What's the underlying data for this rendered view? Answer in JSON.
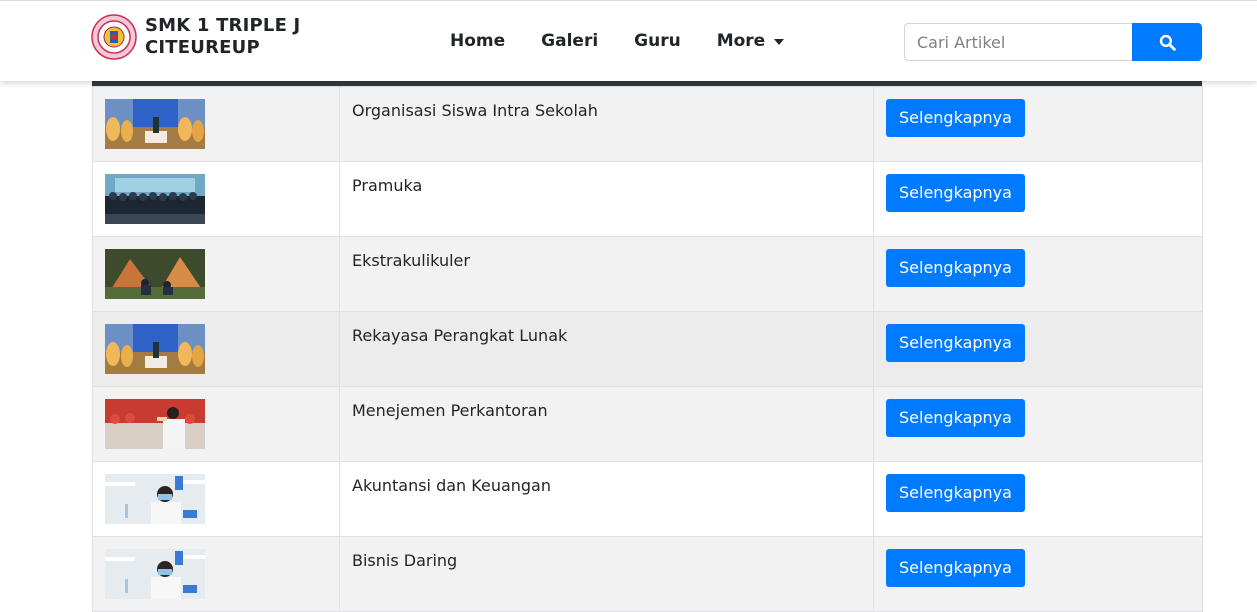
{
  "brand": {
    "line1": "SMK 1 TRIPLE J",
    "line2": "CITEUREUP"
  },
  "nav": [
    {
      "label": "Home"
    },
    {
      "label": "Galeri"
    },
    {
      "label": "Guru"
    },
    {
      "label": "More",
      "dropdown": true
    }
  ],
  "search": {
    "placeholder": "Cari Artikel",
    "icon": "search-icon"
  },
  "colors": {
    "primary": "#007bff",
    "table_header": "#343a40",
    "row_stripe": "#f2f2f2"
  },
  "rows": [
    {
      "title": "Organisasi Siswa Intra Sekolah",
      "button": "Selengkapnya",
      "image": "stage-ceremony"
    },
    {
      "title": "Pramuka",
      "button": "Selengkapnya",
      "image": "group-photo"
    },
    {
      "title": "Ekstrakulikuler",
      "button": "Selengkapnya",
      "image": "camping-tents"
    },
    {
      "title": "Rekayasa Perangkat Lunak",
      "button": "Selengkapnya",
      "image": "stage-ceremony"
    },
    {
      "title": "Menejemen Perkantoran",
      "button": "Selengkapnya",
      "image": "saluting-student"
    },
    {
      "title": "Akuntansi dan Keuangan",
      "button": "Selengkapnya",
      "image": "lab-student"
    },
    {
      "title": "Bisnis Daring",
      "button": "Selengkapnya",
      "image": "lab-student"
    }
  ]
}
